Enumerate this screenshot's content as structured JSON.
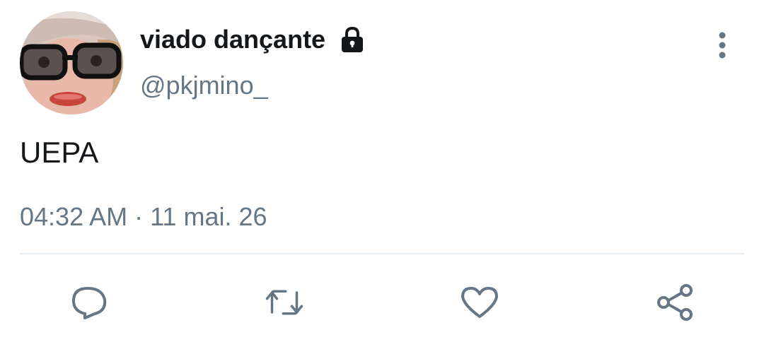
{
  "tweet": {
    "author": {
      "display_name": "viado dançante",
      "handle": "@pkjmino_",
      "protected": true,
      "avatar": "profile-photo-with-glasses"
    },
    "text": "UEPA",
    "timestamp": "04:32 AM · 11 mai. 26",
    "actions": {
      "reply": "reply-icon",
      "retweet": "retweet-icon",
      "like": "heart-icon",
      "share": "share-icon"
    },
    "colors": {
      "text_primary": "#14171a",
      "text_secondary": "#657786",
      "icon": "#657786",
      "divider": "#e6ecf0",
      "background": "#ffffff"
    }
  }
}
